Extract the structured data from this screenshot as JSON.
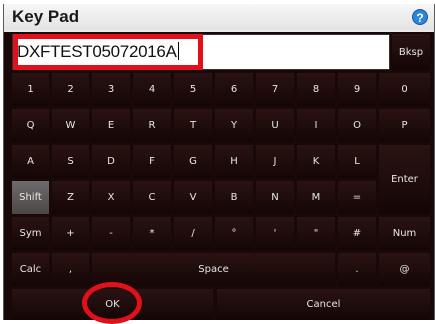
{
  "window": {
    "title": "Key Pad",
    "help_icon": "help-icon",
    "help_glyph": "?"
  },
  "input": {
    "value": "DXFTEST05072016A"
  },
  "keys": {
    "bksp": "Bksp",
    "row1": [
      "1",
      "2",
      "3",
      "4",
      "5",
      "6",
      "7",
      "8",
      "9",
      "0"
    ],
    "row2": [
      "Q",
      "W",
      "E",
      "R",
      "T",
      "Y",
      "U",
      "I",
      "O",
      "P"
    ],
    "row3": [
      "A",
      "S",
      "D",
      "F",
      "G",
      "H",
      "J",
      "K",
      "L"
    ],
    "enter": "Enter",
    "row4": [
      "Shift",
      "Z",
      "X",
      "C",
      "V",
      "B",
      "N",
      "M",
      "="
    ],
    "row5": [
      "Sym",
      "+",
      "-",
      "*",
      "/",
      "°",
      "'",
      "\"",
      "#",
      "Num"
    ],
    "row6": {
      "calc": "Calc",
      "comma": ",",
      "space": "Space",
      "period": ".",
      "at": "@"
    },
    "ok": "OK",
    "cancel": "Cancel"
  },
  "colors": {
    "pad_bg": "#180908",
    "highlight": "#e1101a",
    "shift_active": "#5c5858",
    "title_icon": "#2c86d8"
  }
}
